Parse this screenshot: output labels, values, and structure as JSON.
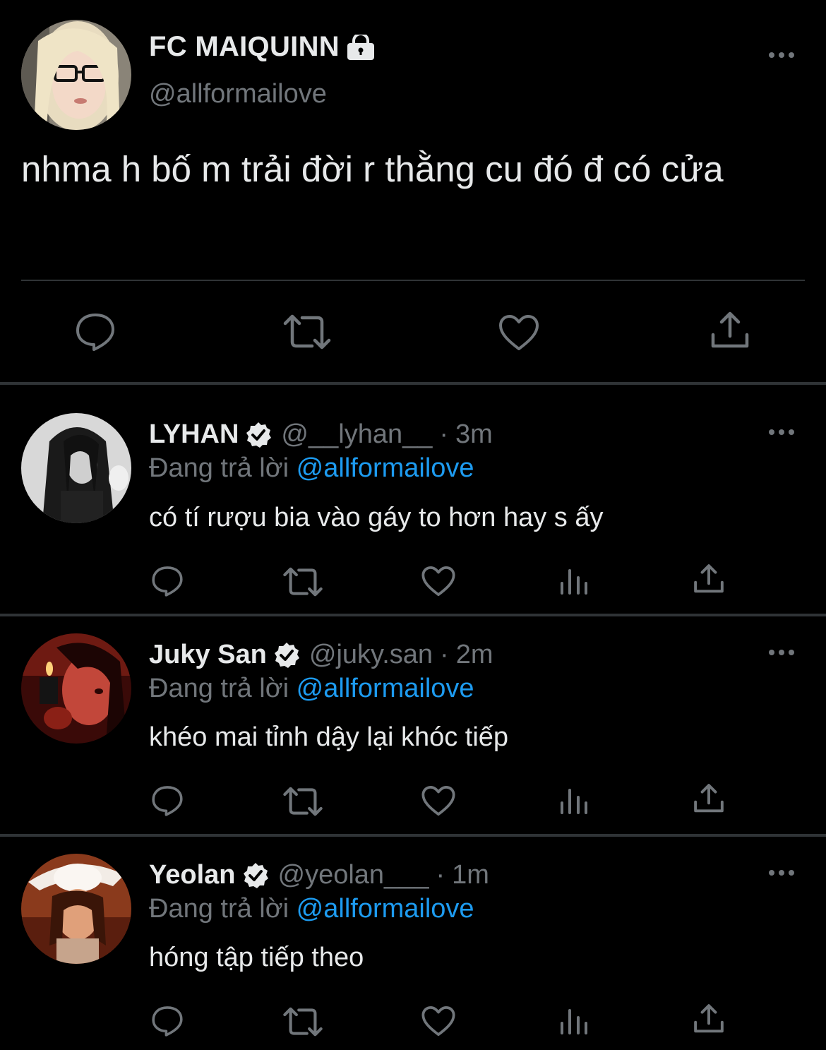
{
  "main_tweet": {
    "name": "FC MAIQUINN",
    "handle": "@allformailove",
    "text": "nhma h bố m trải đời r thằng cu đó đ có cửa",
    "icons": [
      "lock-icon",
      "more-icon",
      "reply-icon",
      "retweet-icon",
      "like-icon",
      "share-icon"
    ]
  },
  "replies": [
    {
      "name": "LYHAN",
      "handle": "@__lyhan__",
      "time": "3m",
      "replying_prefix": "Đang trả lời",
      "replying_to": "@allformailove",
      "text": "có tí rượu bia vào gáy to hơn hay s ấy"
    },
    {
      "name": "Juky San",
      "handle": "@juky.san",
      "time": "2m",
      "replying_prefix": "Đang trả lời",
      "replying_to": "@allformailove",
      "text": "khéo mai tỉnh dậy lại khóc tiếp"
    },
    {
      "name": "Yeolan",
      "handle": "@yeolan___",
      "time": "1m",
      "replying_prefix": "Đang trả lời",
      "replying_to": "@allformailove",
      "text": "hóng tập tiếp theo"
    }
  ],
  "colors": {
    "background": "#000000",
    "text_primary": "#e7e9ea",
    "text_secondary": "#71767b",
    "accent": "#1d9bf0",
    "divider": "#2f3336"
  }
}
